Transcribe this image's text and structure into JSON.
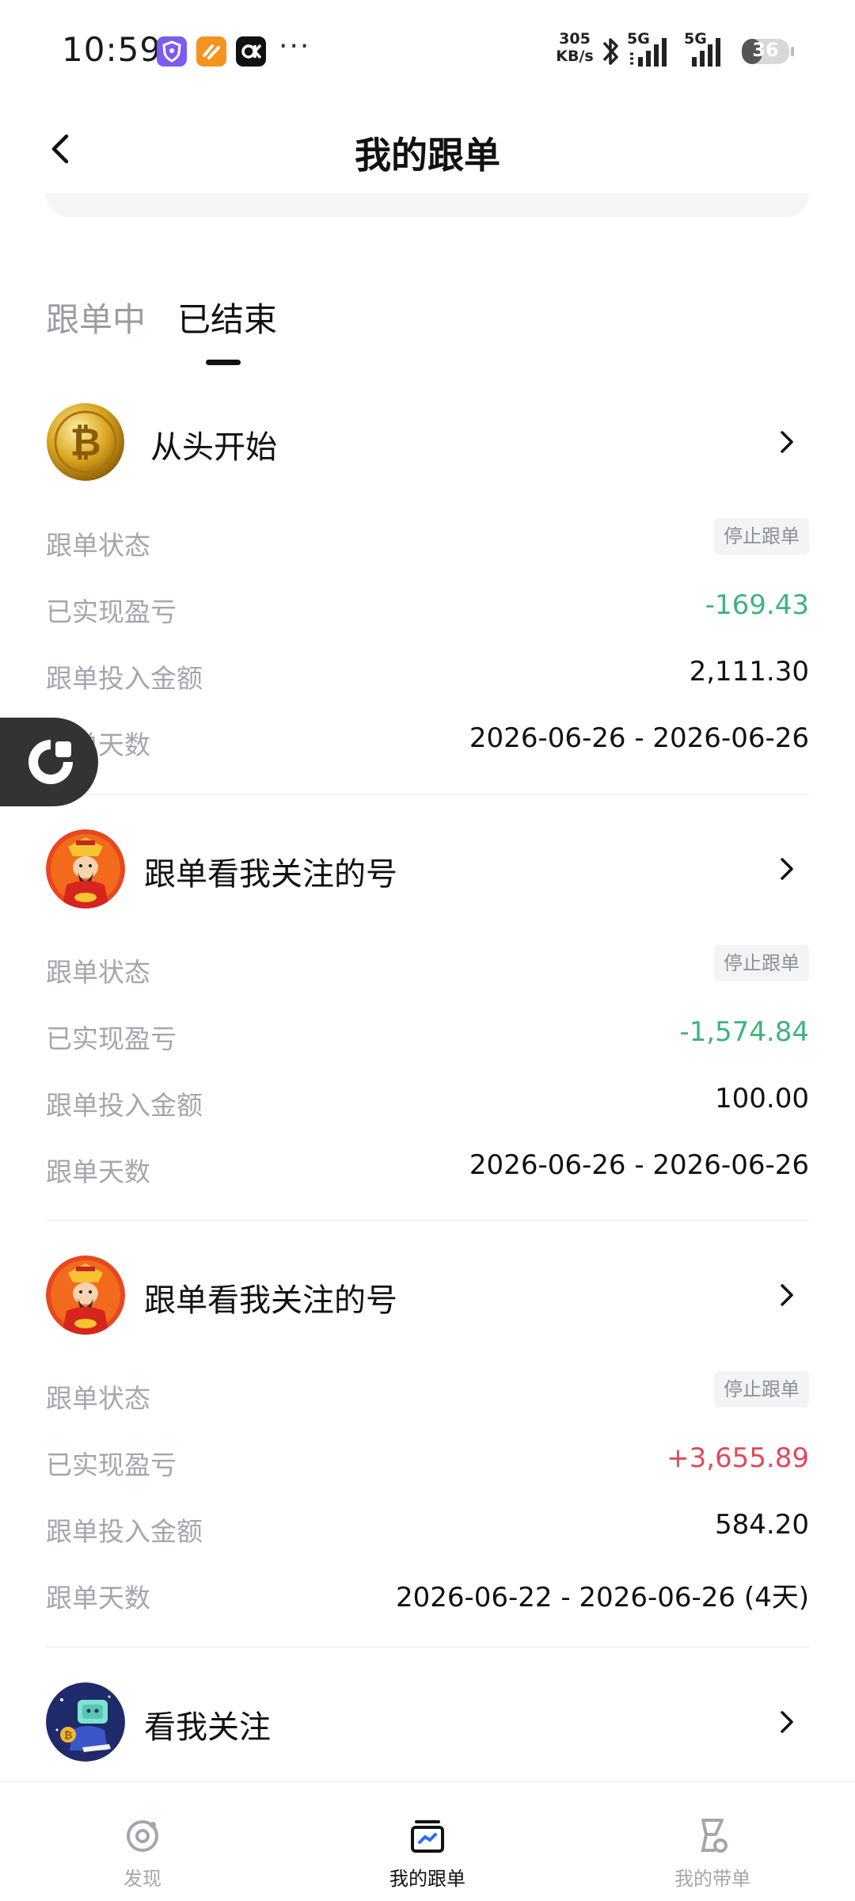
{
  "status_bar": {
    "time": "10:59",
    "net_speed_value": "305",
    "net_speed_unit": "KB/s",
    "signal_1_label": "5G",
    "signal_2_label": "5G",
    "battery": "36",
    "more": "···"
  },
  "header": {
    "title": "我的跟单",
    "back_icon": "chevron-left-icon"
  },
  "tabs": [
    {
      "label": "跟单中",
      "active": false
    },
    {
      "label": "已结束",
      "active": true
    }
  ],
  "orders": [
    {
      "name": "从头开始",
      "avatar": "bitcoin-coin",
      "status_label": "跟单状态",
      "status_value": "停止跟单",
      "pnl_label": "已实现盈亏",
      "pnl_value": "-169.43",
      "pnl_color": "#3fb37f",
      "amount_label": "跟单投入金额",
      "amount_value": "2,111.30",
      "days_label": "跟单天数",
      "days_value": "2026-06-26 - 2026-06-26"
    },
    {
      "name": "跟单看我关注的号",
      "avatar": "god-of-wealth",
      "status_label": "跟单状态",
      "status_value": "停止跟单",
      "pnl_label": "已实现盈亏",
      "pnl_value": "-1,574.84",
      "pnl_color": "#3fb37f",
      "amount_label": "跟单投入金额",
      "amount_value": "100.00",
      "days_label": "跟单天数",
      "days_value": "2026-06-26 - 2026-06-26"
    },
    {
      "name": "跟单看我关注的号",
      "avatar": "god-of-wealth",
      "status_label": "跟单状态",
      "status_value": "停止跟单",
      "pnl_label": "已实现盈亏",
      "pnl_value": "+3,655.89",
      "pnl_color": "#e0495c",
      "amount_label": "跟单投入金额",
      "amount_value": "584.20",
      "days_label": "跟单天数",
      "days_value": "2026-06-22 - 2026-06-26 (4天)"
    },
    {
      "name": "看我关注",
      "avatar": "robot-astronaut"
    }
  ],
  "bottom_nav": [
    {
      "label": "发现",
      "icon": "discover-icon",
      "active": false
    },
    {
      "label": "我的跟单",
      "icon": "my-copytrade-icon",
      "active": true
    },
    {
      "label": "我的带单",
      "icon": "my-lead-icon",
      "active": false
    }
  ]
}
